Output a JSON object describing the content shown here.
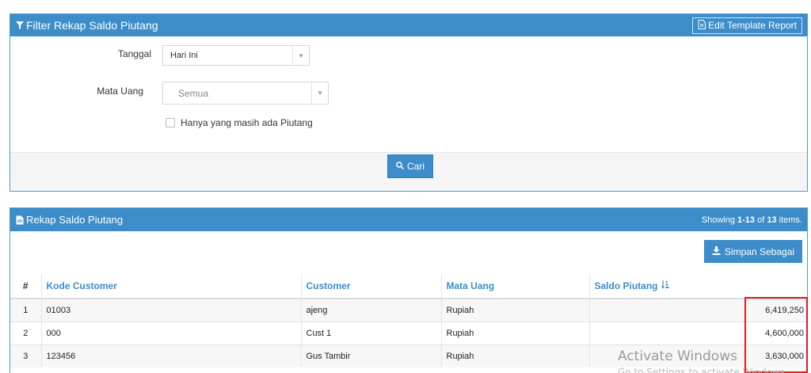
{
  "filter": {
    "title": "Filter Rekap Saldo Piutang",
    "edit_template_label": "Edit Template Report",
    "tanggal_label": "Tanggal",
    "tanggal_value": "Hari Ini",
    "mata_uang_label": "Mata Uang",
    "mata_uang_value": "Semua",
    "checkbox_label": "Hanya yang masih ada Piutang",
    "search_label": "Cari"
  },
  "result": {
    "title": "Rekap Saldo Piutang",
    "showing_prefix": "Showing ",
    "showing_range": "1-13",
    "showing_mid": " of ",
    "showing_total": "13",
    "showing_suffix": " items.",
    "save_as_label": "Simpan Sebagai",
    "columns": [
      "#",
      "Kode Customer",
      "Customer",
      "Mata Uang",
      "Saldo Piutang"
    ],
    "rows": [
      {
        "no": "1",
        "kode": "01003",
        "customer": "ajeng",
        "mata_uang": "Rupiah",
        "saldo": "6,419,250"
      },
      {
        "no": "2",
        "kode": "000",
        "customer": "Cust 1",
        "mata_uang": "Rupiah",
        "saldo": "4,600,000"
      },
      {
        "no": "3",
        "kode": "123456",
        "customer": "Gus Tambir",
        "mata_uang": "Rupiah",
        "saldo": "3,630,000"
      }
    ]
  },
  "watermark": {
    "title": "Activate Windows",
    "subtitle": "Go to Settings to activate Windows."
  },
  "colors": {
    "primary": "#3c8dc9",
    "highlight": "#e21b1b"
  },
  "icons": {
    "filter": "filter-icon",
    "edit_template": "document-icon",
    "search": "search-icon",
    "result": "file-icon",
    "save": "download-icon",
    "sort": "sort-icon",
    "dropdown": "caret-down-icon"
  }
}
